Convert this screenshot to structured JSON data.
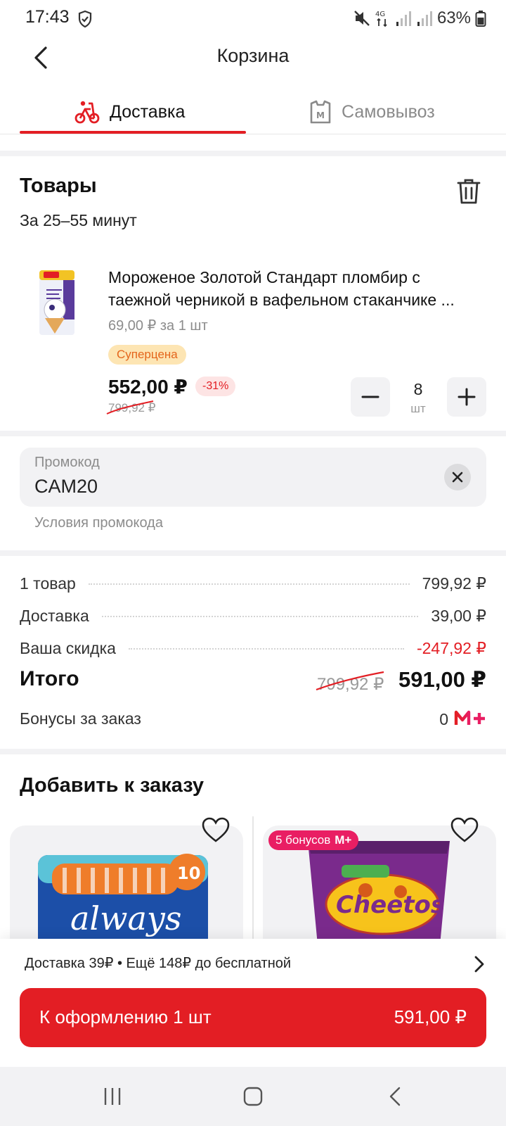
{
  "status_bar": {
    "time": "17:43",
    "battery": "63%"
  },
  "header": {
    "title": "Корзина"
  },
  "tabs": {
    "delivery": "Доставка",
    "pickup": "Самовывоз"
  },
  "goods": {
    "title": "Товары",
    "eta": "За 25–55 минут",
    "item": {
      "name_line1": "Мороженое Золотой Стандарт пломбир с",
      "name_line2": "таежной черникой в вафельном стаканчике ...",
      "unit_price": "69,00 ₽ за 1 шт",
      "badge": "Суперцена",
      "price": "552,00 ₽",
      "discount": "-31%",
      "old_price": "799,92 ₽",
      "quantity": "8",
      "unit": "шт"
    }
  },
  "promo": {
    "label": "Промокод",
    "value": "CAM20",
    "terms": "Условия промокода"
  },
  "summary": {
    "items_label": "1 товар",
    "items_value": "799,92 ₽",
    "delivery_label": "Доставка",
    "delivery_value": "39,00 ₽",
    "discount_label": "Ваша скидка",
    "discount_value": "-247,92 ₽",
    "total_label": "Итого",
    "total_old": "799,92 ₽",
    "total_value": "591,00 ₽",
    "bonus_label": "Бонусы за заказ",
    "bonus_value": "0"
  },
  "add_to_order": {
    "title": "Добавить к заказу",
    "card2_badge": "5 бонусов",
    "card2_badge_logo": "М+"
  },
  "bottom": {
    "delivery_hint": "Доставка 39₽ • Ещё 148₽ до бесплатной",
    "checkout_label": "К оформлению 1 шт",
    "checkout_sum": "591,00 ₽"
  },
  "colors": {
    "accent": "#e31e24",
    "badge_pink": "#e91e63",
    "superprice_bg": "#fde5b3"
  }
}
